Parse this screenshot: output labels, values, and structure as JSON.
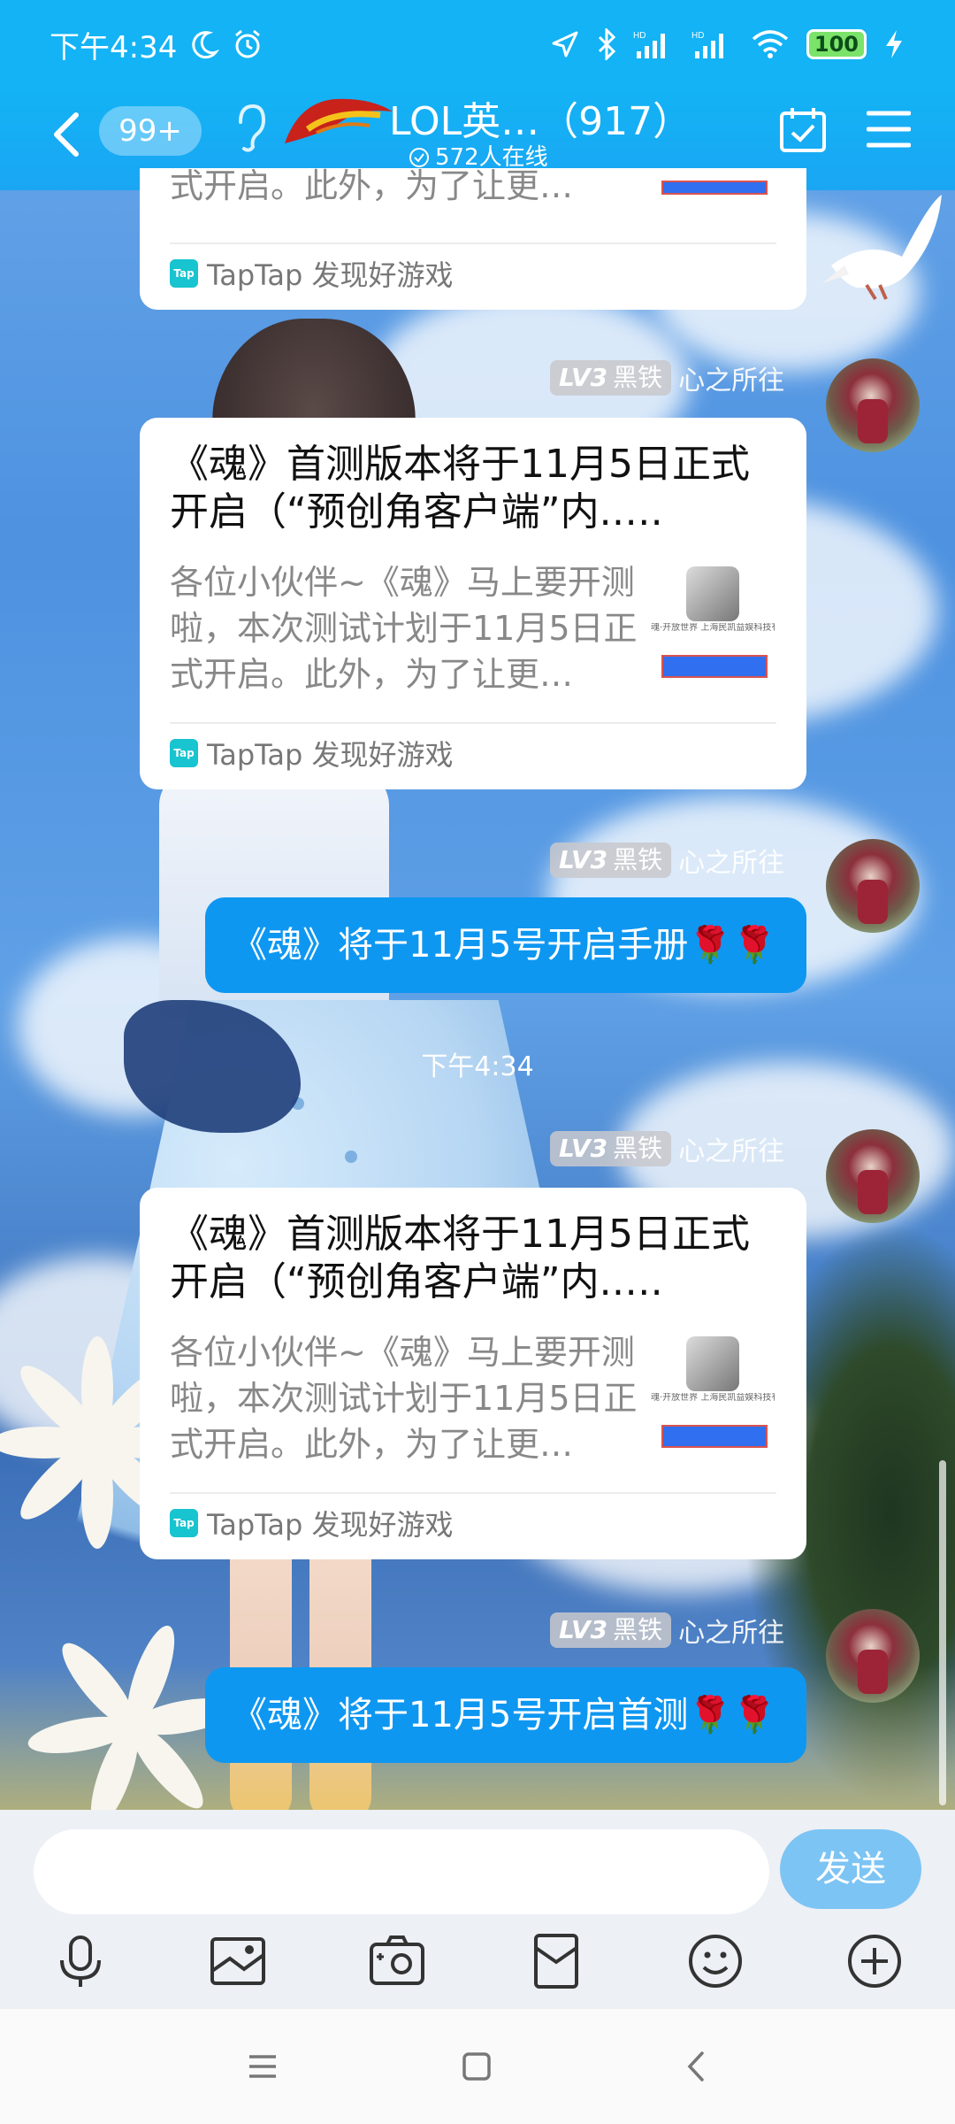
{
  "status_bar": {
    "time": "下午4:34",
    "battery": "100",
    "icons": [
      "moon-icon",
      "alarm-icon",
      "location-icon",
      "bluetooth-icon",
      "signal-icon",
      "wifi-icon",
      "charging-icon"
    ]
  },
  "header": {
    "back_icon": "chevron-left-icon",
    "unread_badge": "99+",
    "title": "LOL英…（917）",
    "online_count": "572人在线",
    "right_icons": [
      "calendar-check-icon",
      "menu-icon"
    ]
  },
  "messages": [
    {
      "kind": "card",
      "title": "",
      "desc": "式开启。此外，为了让更…",
      "source": "TapTap 发现好游戏"
    },
    {
      "kind": "card",
      "level": "LV3",
      "rank": "黑铁",
      "nick": "心之所往",
      "title": "《魂》首测版本将于11月5日正式开启（“预创角客户端”内.….",
      "desc": "各位小伙伴~《魂》马上要开测啦，本次测试计划于11月5日正式开启。此外，为了让更…",
      "thumb_caption": "魂·开放世界 上海民凯益娱科技有限公司 for ll",
      "source": "TapTap 发现好游戏"
    },
    {
      "kind": "text",
      "level": "LV3",
      "rank": "黑铁",
      "nick": "心之所往",
      "text": "《魂》将于11月5号开启手册🌹🌹"
    },
    {
      "kind": "timestamp",
      "text": "下午4:34"
    },
    {
      "kind": "card",
      "level": "LV3",
      "rank": "黑铁",
      "nick": "心之所往",
      "title": "《魂》首测版本将于11月5日正式开启（“预创角客户端”内.….",
      "desc": "各位小伙伴~《魂》马上要开测啦，本次测试计划于11月5日正式开启。此外，为了让更…",
      "thumb_caption": "魂·开放世界 上海民凯益娱科技有限公司 for ll",
      "source": "TapTap 发现好游戏"
    },
    {
      "kind": "text",
      "level": "LV3",
      "rank": "黑铁",
      "nick": "心之所往",
      "text": "《魂》将于11月5号开启首测🌹🌹"
    }
  ],
  "input": {
    "placeholder": "",
    "send_label": "发送",
    "tools": [
      "microphone-icon",
      "image-icon",
      "camera-icon",
      "red-packet-icon",
      "emoji-icon",
      "plus-icon"
    ]
  },
  "nav_bar": {
    "buttons": [
      "recent-apps-icon",
      "home-icon",
      "back-icon"
    ]
  },
  "colors": {
    "header": "#13b3f5",
    "bubble": "#0e97f1",
    "send": "#7cc4f4",
    "tap": "#17c4cf"
  }
}
